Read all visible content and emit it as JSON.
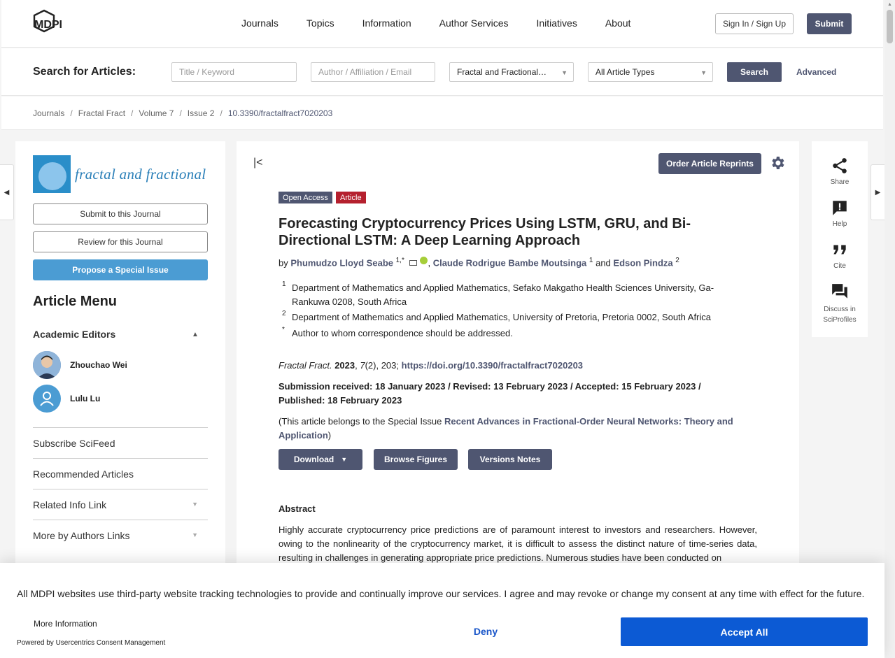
{
  "header": {
    "logo_text": "MDPI",
    "nav": [
      "Journals",
      "Topics",
      "Information",
      "Author Services",
      "Initiatives",
      "About"
    ],
    "sign_in": "Sign In / Sign Up",
    "submit": "Submit"
  },
  "search": {
    "label": "Search for Articles:",
    "keyword_placeholder": "Title / Keyword",
    "author_placeholder": "Author / Affiliation / Email",
    "journal_selected": "Fractal and Fractional…",
    "type_selected": "All Article Types",
    "search_button": "Search",
    "advanced": "Advanced"
  },
  "breadcrumb": [
    "Journals",
    "Fractal Fract",
    "Volume 7",
    "Issue 2",
    "10.3390/fractalfract7020203"
  ],
  "left": {
    "journal_logo_text": "fractal and fractional",
    "submit_btn": "Submit to this Journal",
    "review_btn": "Review for this Journal",
    "propose_btn": "Propose a Special Issue",
    "menu_title": "Article Menu",
    "academic_editors_title": "Academic Editors",
    "editors": [
      "Zhouchao Wei",
      "Lulu Lu"
    ],
    "menu_items": [
      "Subscribe SciFeed",
      "Recommended Articles",
      "Related Info Link",
      "More by Authors Links"
    ]
  },
  "article": {
    "order_reprints": "Order Article Reprints",
    "badge_open_access": "Open Access",
    "badge_type": "Article",
    "title": "Forecasting Cryptocurrency Prices Using LSTM, GRU, and Bi-Directional LSTM: A Deep Learning Approach",
    "by": "by",
    "authors": [
      {
        "name": "Phumudzo Lloyd Seabe",
        "sup": "1,*"
      },
      {
        "name": "Claude Rodrigue Bambe Moutsinga",
        "sup": "1"
      },
      {
        "name": "Edson Pindza",
        "sup": "2"
      }
    ],
    "and": "and",
    "affiliations": [
      {
        "num": "1",
        "text": "Department of Mathematics and Applied Mathematics, Sefako Makgatho Health Sciences University, Ga-Rankuwa 0208, South Africa"
      },
      {
        "num": "2",
        "text": "Department of Mathematics and Applied Mathematics, University of Pretoria, Pretoria 0002, South Africa"
      },
      {
        "num": "*",
        "text": "Author to whom correspondence should be addressed."
      }
    ],
    "citation": {
      "journal": "Fractal Fract.",
      "year": "2023",
      "volume": "7",
      "rest": "(2), 203;",
      "doi": "https://doi.org/10.3390/fractalfract7020203"
    },
    "dates": "Submission received: 18 January 2023 / Revised: 13 February 2023 / Accepted: 15 February 2023 / Published: 18 February 2023",
    "special_issue_prefix": "(This article belongs to the Special Issue ",
    "special_issue_name": "Recent Advances in Fractional-Order Neural Networks: Theory and Application",
    "special_issue_suffix": ")",
    "download": "Download",
    "browse_figures": "Browse Figures",
    "versions_notes": "Versions Notes",
    "abstract_heading": "Abstract",
    "abstract_text": "Highly accurate cryptocurrency price predictions are of paramount interest to investors and researchers. However, owing to the nonlinearity of the cryptocurrency market, it is difficult to assess the distinct nature of time-series data, resulting in challenges in generating appropriate price predictions. Numerous studies have been conducted on"
  },
  "tools": [
    {
      "label": "Share",
      "icon": "share-icon"
    },
    {
      "label": "Help",
      "icon": "help-icon"
    },
    {
      "label": "Cite",
      "icon": "quote-icon"
    },
    {
      "label": "Discuss in SciProfiles",
      "icon": "forum-icon"
    }
  ],
  "consent": {
    "text": "All MDPI websites use third-party website tracking technologies to provide and continually improve our services. I agree and may revoke or change my consent at any time with effect for the future.",
    "more_info": "More Information",
    "powered_by": "Powered by Usercentrics Consent Management",
    "deny": "Deny",
    "accept": "Accept All"
  },
  "colors": {
    "brand": "#4f5671",
    "article_badge": "#b5202e",
    "journal_blue": "#4b9cd3",
    "accept_blue": "#0c5ad4"
  }
}
